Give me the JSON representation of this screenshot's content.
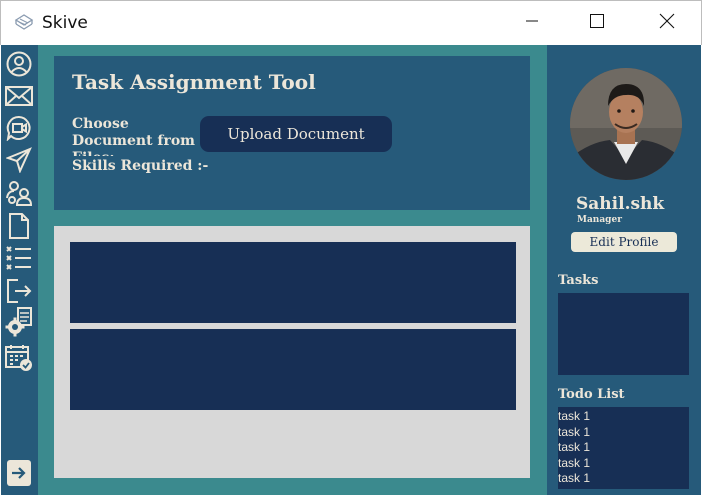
{
  "window": {
    "title": "Skive"
  },
  "sidebar": {
    "items": [
      {
        "icon": "profile-icon"
      },
      {
        "icon": "mail-icon"
      },
      {
        "icon": "video-chat-icon"
      },
      {
        "icon": "send-icon"
      },
      {
        "icon": "team-icon"
      },
      {
        "icon": "document-icon"
      },
      {
        "icon": "task-list-icon"
      },
      {
        "icon": "logout-icon"
      },
      {
        "icon": "settings-document-icon"
      },
      {
        "icon": "calendar-check-icon"
      },
      {
        "icon": "collapse-arrow-icon"
      }
    ]
  },
  "main": {
    "title": "Task Assignment Tool",
    "choose_label": "Choose Document from Files:-",
    "upload_button": "Upload Document",
    "skills_label": "Skills Required :-"
  },
  "profile": {
    "name": "Sahil.shk",
    "role": "Manager",
    "edit_button": "Edit Profile"
  },
  "tasks": {
    "label": "Tasks",
    "items": []
  },
  "todo": {
    "label": "Todo List",
    "items": [
      "task 1",
      "task 1",
      "task 1",
      "task 1",
      "task 1"
    ]
  },
  "colors": {
    "sidebar": "#265a7a",
    "frame": "#3b8a8e",
    "card": "#172f55",
    "text_light": "#ece6d9",
    "content_bg": "#d8d8d8"
  }
}
